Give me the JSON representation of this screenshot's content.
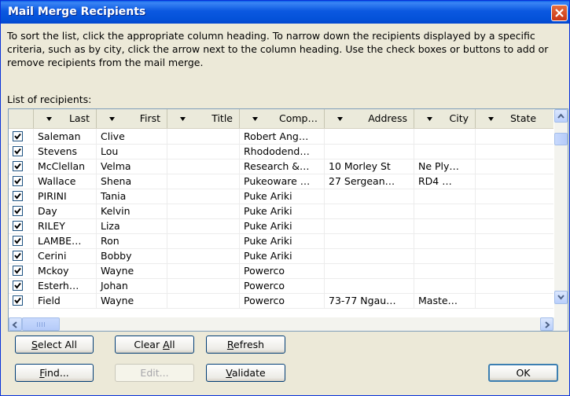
{
  "window": {
    "title": "Mail Merge Recipients"
  },
  "instructions": "To sort the list, click the appropriate column heading.  To narrow down the recipients displayed by a specific criteria, such as by city, click the arrow next to the column heading.  Use the check boxes or buttons to add or remove recipients from the mail merge.",
  "list_label": "List of recipients:",
  "columns": [
    "Last",
    "First",
    "Title",
    "Comp…",
    "Address",
    "City",
    "State"
  ],
  "rows": [
    {
      "checked": true,
      "last": "Saleman",
      "first": "Clive",
      "title": "",
      "company": "Robert Ang…",
      "address": "",
      "city": "",
      "state": ""
    },
    {
      "checked": true,
      "last": "Stevens",
      "first": "Lou",
      "title": "",
      "company": "Rhododend…",
      "address": "",
      "city": "",
      "state": ""
    },
    {
      "checked": true,
      "last": "McClellan",
      "first": "Velma",
      "title": "",
      "company": "Research &…",
      "address": "10 Morley St",
      "city": "Ne Ply…",
      "state": ""
    },
    {
      "checked": true,
      "last": "Wallace",
      "first": "Shena",
      "title": "",
      "company": "Pukeoware …",
      "address": "27 Sergean…",
      "city": "RD4 …",
      "state": ""
    },
    {
      "checked": true,
      "last": "PIRINI",
      "first": "Tania",
      "title": "",
      "company": "Puke Ariki",
      "address": "",
      "city": "",
      "state": ""
    },
    {
      "checked": true,
      "last": "Day",
      "first": "Kelvin",
      "title": "",
      "company": "Puke Ariki",
      "address": "",
      "city": "",
      "state": ""
    },
    {
      "checked": true,
      "last": "RILEY",
      "first": "Liza",
      "title": "",
      "company": "Puke Ariki",
      "address": "",
      "city": "",
      "state": ""
    },
    {
      "checked": true,
      "last": "LAMBE…",
      "first": "Ron",
      "title": "",
      "company": "Puke Ariki",
      "address": "",
      "city": "",
      "state": ""
    },
    {
      "checked": true,
      "last": "Cerini",
      "first": "Bobby",
      "title": "",
      "company": "Puke Ariki",
      "address": "",
      "city": "",
      "state": ""
    },
    {
      "checked": true,
      "last": "Mckoy",
      "first": "Wayne",
      "title": "",
      "company": "Powerco",
      "address": "",
      "city": "",
      "state": ""
    },
    {
      "checked": true,
      "last": "Esterh…",
      "first": "Johan",
      "title": "",
      "company": "Powerco",
      "address": "",
      "city": "",
      "state": ""
    },
    {
      "checked": true,
      "last": "Field",
      "first": "Wayne",
      "title": "",
      "company": "Powerco",
      "address": "73-77 Ngau…",
      "city": "Maste…",
      "state": ""
    }
  ],
  "buttons": {
    "select_all": {
      "pre": "",
      "ul": "S",
      "post": "elect All"
    },
    "clear_all": {
      "pre": "Clear ",
      "ul": "A",
      "post": "ll"
    },
    "refresh": {
      "pre": "",
      "ul": "R",
      "post": "efresh"
    },
    "find": {
      "pre": "",
      "ul": "F",
      "post": "ind..."
    },
    "edit": "Edit...",
    "validate": {
      "pre": "",
      "ul": "V",
      "post": "alidate"
    },
    "ok": "OK"
  }
}
